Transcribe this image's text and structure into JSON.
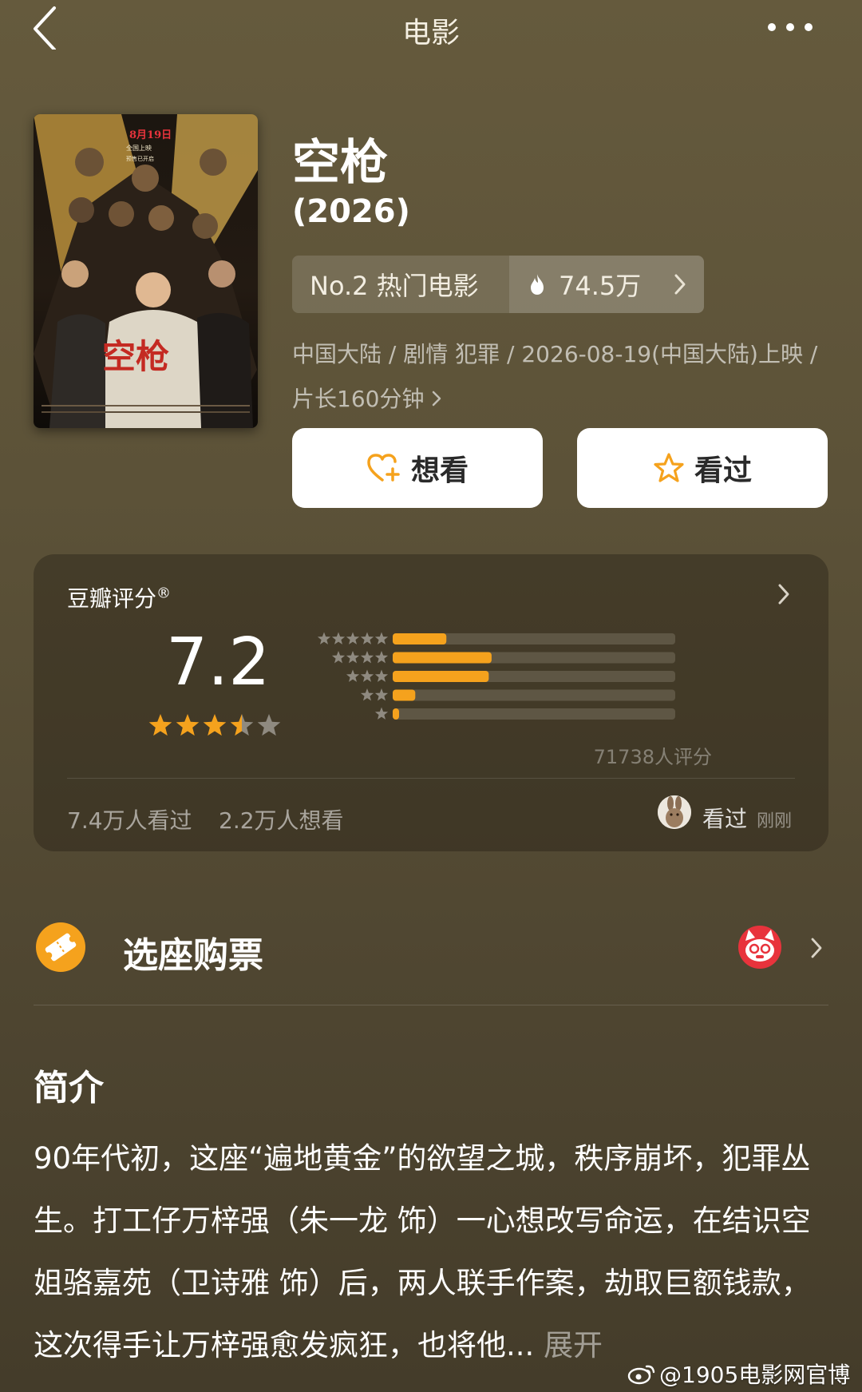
{
  "header": {
    "title": "电影"
  },
  "movie": {
    "title": "空枪",
    "year": "(2026)",
    "rank": "No.2 热门电影",
    "heat": "74.5万",
    "meta_line": "中国大陆 / 剧情 犯罪 / 2026-08-19(中国大陆)上映 / 片长160分钟",
    "poster": {
      "release_date": "8月19日",
      "release_line1": "全国上映",
      "release_line2": "预售已开启",
      "title_art": "空枪"
    }
  },
  "actions": {
    "want_label": "想看",
    "seen_label": "看过"
  },
  "rating": {
    "source": "豆瓣评分",
    "registered_mark": "®",
    "score": "7.2",
    "star_value": 3.5,
    "distribution": [
      {
        "stars": 5,
        "fraction": 0.19
      },
      {
        "stars": 4,
        "fraction": 0.35
      },
      {
        "stars": 3,
        "fraction": 0.34
      },
      {
        "stars": 2,
        "fraction": 0.08
      },
      {
        "stars": 1,
        "fraction": 0.02
      }
    ],
    "count": "71738人评分",
    "seen_count": "7.4万人看过",
    "want_count": "2.2万人想看",
    "friend_status": "看过",
    "friend_time": "刚刚"
  },
  "ticket": {
    "label": "选座购票"
  },
  "summary": {
    "heading": "简介",
    "text": "90年代初，这座“遍地黄金”的欲望之城，秩序崩坏，犯罪丛生。打工仔万梓强（朱一龙 饰）一心想改写命运，在结识空姐骆嘉苑（卫诗雅 饰）后，两人联手作案，劫取巨额钱款，这次得手让万梓强愈发疯狂，也将他...",
    "expand": "展开"
  },
  "watermark": "@1905电影网官博",
  "colors": {
    "accent_orange": "#f5a21d",
    "bar_track": "#5e5644",
    "star_gray": "#8f8a80",
    "maoyan_red": "#e8333c"
  }
}
